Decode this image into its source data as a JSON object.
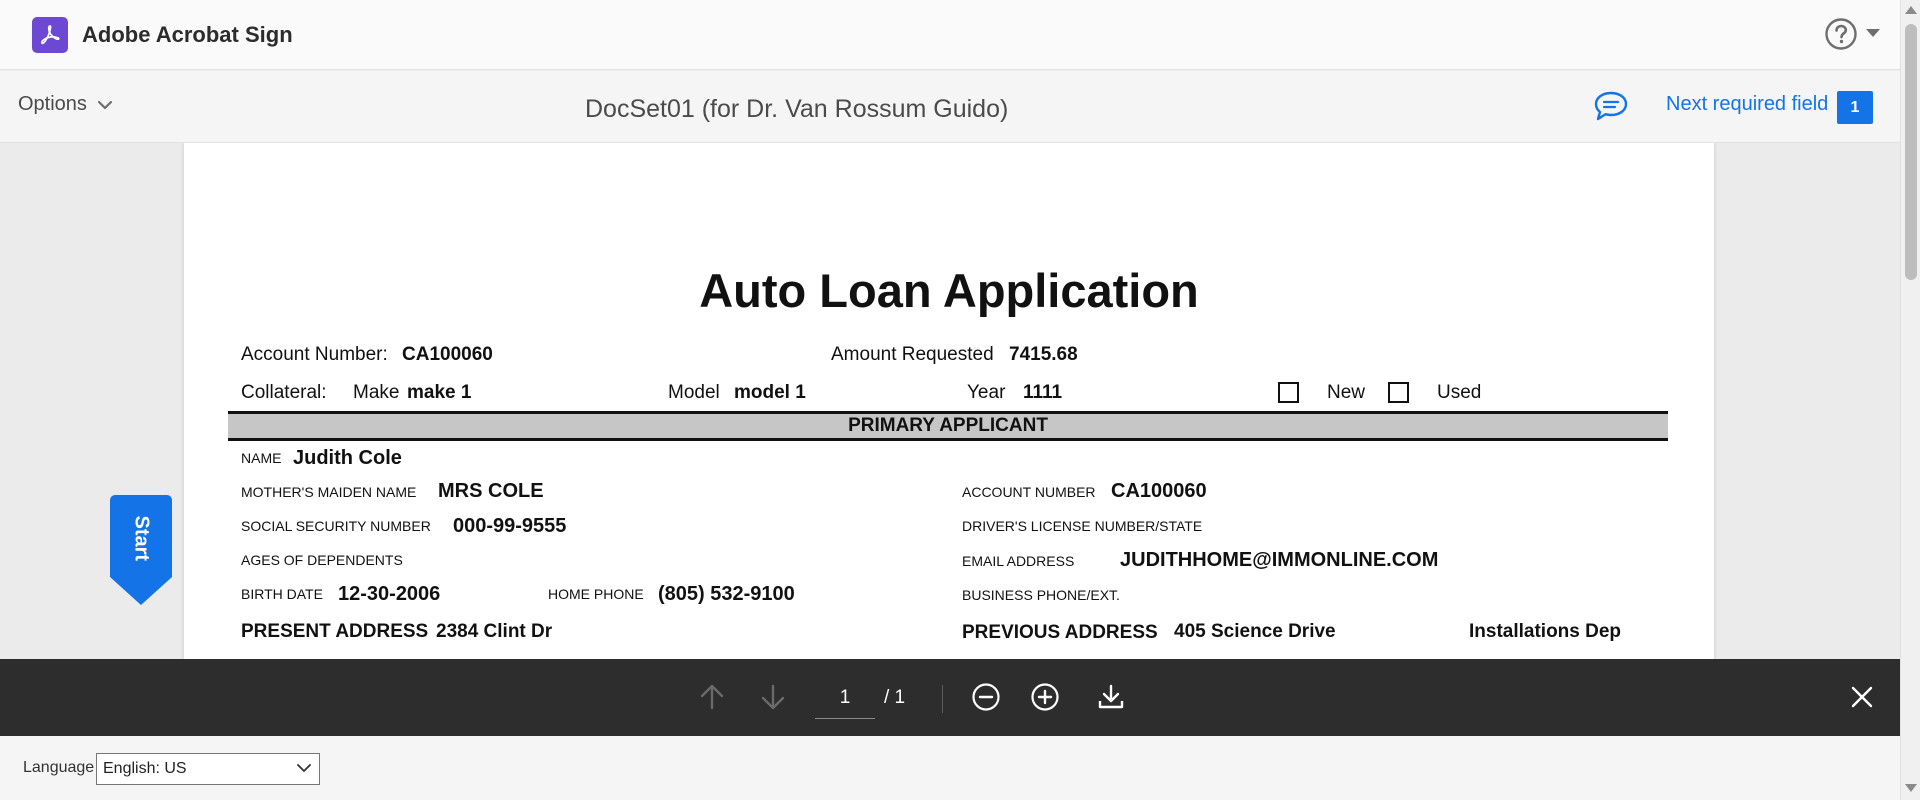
{
  "app": {
    "title": "Adobe Acrobat Sign",
    "logo_icon": "acrobat-logo-icon",
    "brand_color": "#6d49d3"
  },
  "toolbar": {
    "options_label": "Options",
    "document_title": "DocSet01 (for Dr. Van Rossum Guido)",
    "next_field_label": "Next required field",
    "next_field_count": "1",
    "accent": "#1473e6"
  },
  "document": {
    "form_title": "Auto Loan Application",
    "account_number_label": "Account Number:",
    "account_number_value": "CA100060",
    "amount_requested_label": "Amount Requested",
    "amount_requested_value": "7415.68",
    "collateral_label": "Collateral:",
    "make_label": "Make",
    "make_value": "make 1",
    "model_label": "Model",
    "model_value": "model 1",
    "year_label": "Year",
    "year_value": "1111",
    "new_label": "New",
    "used_label": "Used",
    "section_title": "PRIMARY APPLICANT",
    "name_label": "NAME",
    "name_value": "Judith Cole",
    "maiden_label": "MOTHER'S MAIDEN NAME",
    "maiden_value": "MRS COLE",
    "applicant_account_label": "ACCOUNT NUMBER",
    "applicant_account_value": "CA100060",
    "ssn_label": "SOCIAL SECURITY NUMBER",
    "ssn_value": "000-99-9555",
    "license_label": "DRIVER'S LICENSE NUMBER/STATE",
    "dependents_label": "AGES OF DEPENDENTS",
    "email_label": "EMAIL ADDRESS",
    "email_value": "JUDITHHOME@IMMONLINE.COM",
    "birth_label": "BIRTH DATE",
    "birth_value": "12-30-2006",
    "home_phone_label": "HOME PHONE",
    "home_phone_value": "(805) 532-9100",
    "business_phone_label": "BUSINESS PHONE/EXT.",
    "present_address_label": "PRESENT ADDRESS",
    "present_address_value": "2384 Clint Dr",
    "previous_address_label": "PREVIOUS ADDRESS",
    "previous_address_value": "405 Science Drive",
    "previous_address_extra": "Installations Dep"
  },
  "start_tab": {
    "label": "Start"
  },
  "controls": {
    "current_page": "1",
    "total_pages": "/ 1"
  },
  "footer": {
    "language_label": "Language",
    "language_value": "English: US"
  }
}
